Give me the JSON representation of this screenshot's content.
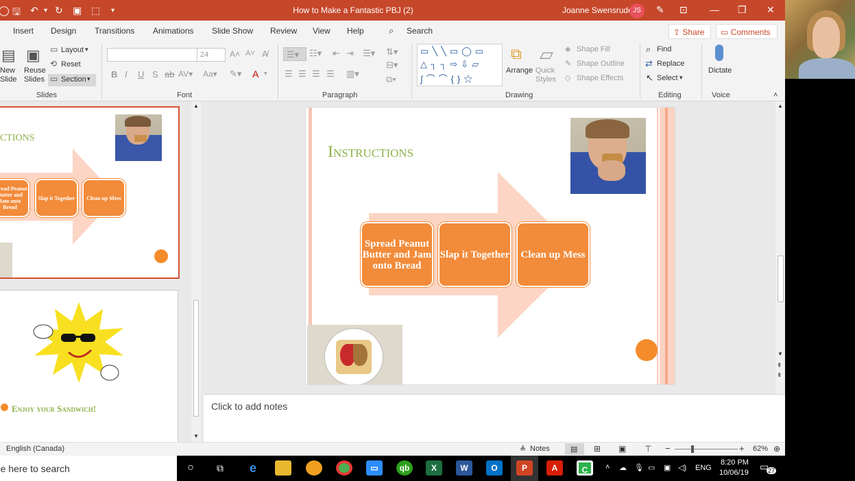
{
  "window": {
    "title": "How to Make a Fantastic PBJ (2)",
    "user_name": "Joanne Swensrude",
    "user_initials": "JS"
  },
  "tabs": [
    "Insert",
    "Design",
    "Transitions",
    "Animations",
    "Slide Show",
    "Review",
    "View",
    "Help"
  ],
  "search_label": "Search",
  "share_label": "Share",
  "comments_label": "Comments",
  "ribbon": {
    "slides": {
      "new_slide": "New Slide",
      "reuse_slides": "Reuse Slides",
      "layout": "Layout",
      "reset": "Reset",
      "section": "Section",
      "group_label": "Slides"
    },
    "font": {
      "font_name": "",
      "font_size": "24",
      "group_label": "Font"
    },
    "paragraph": {
      "group_label": "Paragraph"
    },
    "drawing": {
      "arrange": "Arrange",
      "quick_styles": "Quick Styles",
      "shape_fill": "Shape Fill",
      "shape_outline": "Shape Outline",
      "shape_effects": "Shape Effects",
      "group_label": "Drawing"
    },
    "editing": {
      "find": "Find",
      "replace": "Replace",
      "select": "Select",
      "group_label": "Editing"
    },
    "voice": {
      "dictate": "Dictate",
      "group_label": "Voice"
    }
  },
  "thumbnails": {
    "slide1": {
      "title_fragment": "CTIONS",
      "box1": "Spread Peanut Butter and Jam onto Bread",
      "box2": "Slap it Together",
      "box3": "Clean up Mess"
    },
    "slide2": {
      "title": "Enjoy your Sandwich!"
    }
  },
  "slide": {
    "title": "Instructions",
    "steps": [
      "Spread Peanut Butter and Jam onto Bread",
      "Slap it Together",
      "Clean up Mess"
    ]
  },
  "notes_placeholder": "Click to add notes",
  "status": {
    "language": "English (Canada)",
    "notes_label": "Notes",
    "zoom": "62%"
  },
  "taskbar": {
    "search_text": "Type here to search",
    "language": "ENG",
    "time": "8:20 PM",
    "date": "10/06/19",
    "notifications": "27"
  },
  "colors": {
    "accent": "#c6472a",
    "title_green": "#8fb14a",
    "step_orange": "#f28b3a",
    "arrow_peach": "#fcd5c4"
  }
}
